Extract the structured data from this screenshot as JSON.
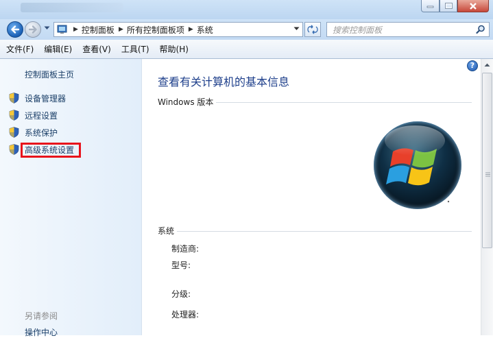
{
  "window": {
    "controls": {
      "minimize_icon": "minimize-icon",
      "maximize_icon": "maximize-icon",
      "close_icon": "close-icon"
    }
  },
  "address_bar": {
    "breadcrumbs": [
      "控制面板",
      "所有控制面板项",
      "系统"
    ],
    "search_placeholder": "搜索控制面板"
  },
  "menu": {
    "items": [
      "文件(F)",
      "编辑(E)",
      "查看(V)",
      "工具(T)",
      "帮助(H)"
    ]
  },
  "sidebar": {
    "home_link": "控制面板主页",
    "tasks": [
      {
        "label": "设备管理器",
        "icon": "uac-shield-icon"
      },
      {
        "label": "远程设置",
        "icon": "uac-shield-icon"
      },
      {
        "label": "系统保护",
        "icon": "uac-shield-icon"
      },
      {
        "label": "高级系统设置",
        "icon": "uac-shield-icon",
        "highlighted": true
      }
    ],
    "see_also_heading": "另请参阅",
    "see_also_links": [
      "操作中心"
    ]
  },
  "main": {
    "help_glyph": "?",
    "title": "查看有关计算机的基本信息",
    "windows_edition_heading": "Windows 版本",
    "system_heading": "系统",
    "system_props": [
      {
        "label": "制造商:"
      },
      {
        "label": "型号:"
      },
      {
        "label": "分级:"
      },
      {
        "label": "处理器:"
      }
    ]
  },
  "colors": {
    "link": "#1b3f68",
    "title": "#1e3f8b",
    "highlight_box": "#e8131b",
    "chrome": "#c3daf3"
  }
}
